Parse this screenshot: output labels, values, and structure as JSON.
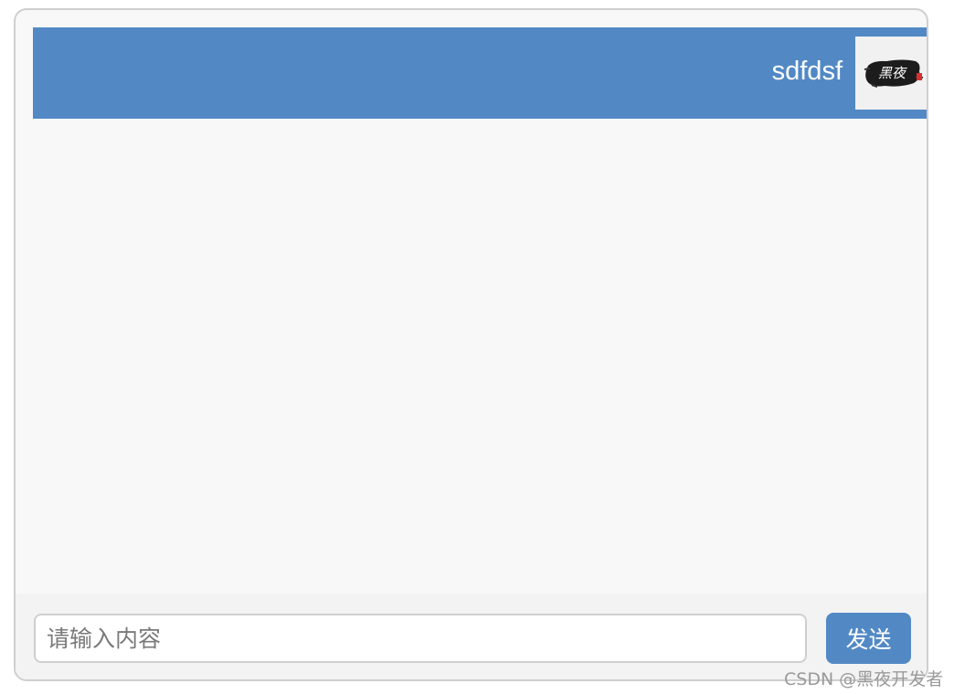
{
  "header": {
    "username": "sdfdsf",
    "avatar_text": "黑夜"
  },
  "composer": {
    "placeholder": "请输入内容",
    "value": "",
    "send_label": "发送"
  },
  "watermark": "CSDN @黑夜开发者",
  "colors": {
    "accent": "#5289c5",
    "window_background": "#f8f8f8",
    "footer_background": "#f3f3f3",
    "border": "#cfcfcf"
  }
}
